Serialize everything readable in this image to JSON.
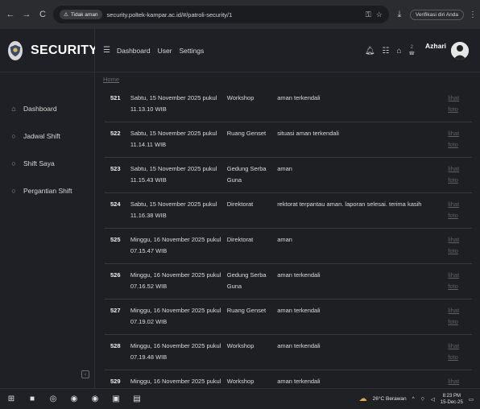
{
  "browser": {
    "back": "←",
    "forward": "→",
    "reload": "C",
    "security_warning": "Tidak aman",
    "url": "security.poltek-kampar.ac.id/#/patroli-security/1",
    "verify_label": "Verifikasi diri Anda",
    "menu": "⋮"
  },
  "sidebar": {
    "brand": "SECURITY",
    "items": [
      {
        "label": "Dashboard",
        "icon": "home-icon"
      },
      {
        "label": "Jadwal Shift",
        "icon": "circle-icon"
      },
      {
        "label": "Shift Saya",
        "icon": "circle-icon"
      },
      {
        "label": "Pergantian Shift",
        "icon": "circle-icon"
      }
    ]
  },
  "topnav": {
    "links": [
      "Dashboard",
      "User",
      "Settings"
    ],
    "user_name": "Azhari",
    "badge": "2"
  },
  "breadcrumb": "Home",
  "table": {
    "link_line1": "lihat",
    "link_line2": "foto",
    "rows": [
      {
        "no": "521",
        "time_line1": "Sabtu, 15 November 2025 pukul",
        "time_line2": "11.13.10 WIB",
        "loc_line1": "Workshop",
        "loc_line2": "",
        "desc": "aman terkendali"
      },
      {
        "no": "522",
        "time_line1": "Sabtu, 15 November 2025 pukul",
        "time_line2": "11.14.11 WIB",
        "loc_line1": "Ruang Genset",
        "loc_line2": "",
        "desc": "situasi aman terkendali"
      },
      {
        "no": "523",
        "time_line1": "Sabtu, 15 November 2025 pukul",
        "time_line2": "11.15.43 WIB",
        "loc_line1": "Gedung Serba",
        "loc_line2": "Guna",
        "desc": "aman"
      },
      {
        "no": "524",
        "time_line1": "Sabtu, 15 November 2025 pukul",
        "time_line2": "11.16.38 WIB",
        "loc_line1": "Direktorat",
        "loc_line2": "",
        "desc": "rektorat terpantau aman. laporan selesai. terima kasih"
      },
      {
        "no": "525",
        "time_line1": "Minggu, 16 November 2025 pukul",
        "time_line2": "07.15.47 WIB",
        "loc_line1": "Direktorat",
        "loc_line2": "",
        "desc": "aman"
      },
      {
        "no": "526",
        "time_line1": "Minggu, 16 November 2025 pukul",
        "time_line2": "07.16.52 WIB",
        "loc_line1": "Gedung Serba",
        "loc_line2": "Guna",
        "desc": "aman terkendali"
      },
      {
        "no": "527",
        "time_line1": "Minggu, 16 November 2025 pukul",
        "time_line2": "07.19.02 WIB",
        "loc_line1": "Ruang Genset",
        "loc_line2": "",
        "desc": "aman terkendali"
      },
      {
        "no": "528",
        "time_line1": "Minggu, 16 November 2025 pukul",
        "time_line2": "07.19.48 WIB",
        "loc_line1": "Workshop",
        "loc_line2": "",
        "desc": "aman terkendali"
      },
      {
        "no": "529",
        "time_line1": "Minggu, 16 November 2025 pukul",
        "time_line2": "",
        "loc_line1": "Workshop",
        "loc_line2": "",
        "desc": "aman terkendali"
      }
    ]
  },
  "taskbar": {
    "weather": "26°C Berawan",
    "time": "8:23 PM",
    "date": "15-Dec-25"
  }
}
